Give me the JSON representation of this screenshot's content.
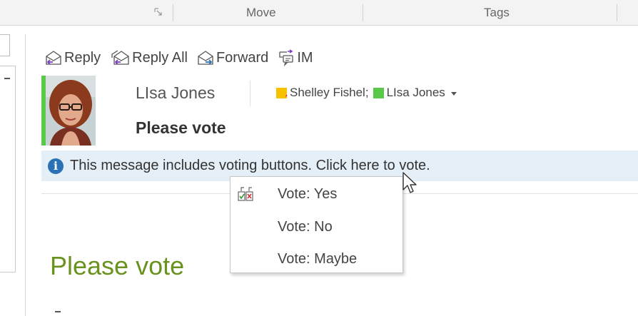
{
  "ribbon": {
    "groups": [
      {
        "label": "Move"
      },
      {
        "label": "Tags"
      }
    ]
  },
  "actions": [
    {
      "label": "Reply",
      "icon": "reply-icon"
    },
    {
      "label": "Reply All",
      "icon": "reply-all-icon"
    },
    {
      "label": "Forward",
      "icon": "forward-icon"
    },
    {
      "label": "IM",
      "icon": "im-icon"
    }
  ],
  "message": {
    "sender": "LIsa Jones",
    "recipients": [
      {
        "name": "Shelley Fishel;",
        "category_color": "#f7c200"
      },
      {
        "name": "LIsa Jones",
        "category_color": "#5ac94a"
      }
    ],
    "subject": "Please vote",
    "infobar_text": "This message includes voting buttons. Click here to vote.",
    "body_heading": "Please vote"
  },
  "vote_menu": {
    "items": [
      {
        "label": "Vote: Yes"
      },
      {
        "label": "Vote: No"
      },
      {
        "label": "Vote: Maybe"
      }
    ]
  },
  "colors": {
    "accent_green": "#5ac94a",
    "info_blue": "#2a72b5",
    "infobar_bg": "#e4eff7",
    "heading_green": "#6a921f"
  }
}
